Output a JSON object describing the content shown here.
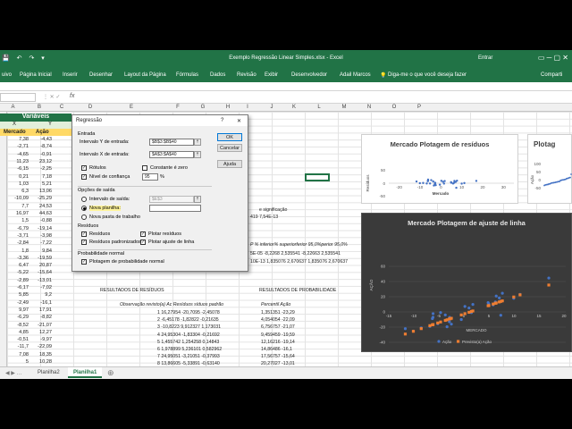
{
  "window": {
    "title": "Exemplo Regressão Linear Simples.xlsx - Excel",
    "sign_in": "Entrar",
    "share": "Comparti"
  },
  "ribbon": {
    "tabs": [
      "uivo",
      "Página Inicial",
      "Inserir",
      "Desenhar",
      "Layout da Página",
      "Fórmulas",
      "Dados",
      "Revisão",
      "Exibir",
      "Desenvolvedor",
      "Adail Marcos"
    ],
    "tell_me": "Diga-me o que você deseja fazer"
  },
  "formula_bar": {
    "fx": "fx"
  },
  "columns": [
    "A",
    "B",
    "C",
    "D",
    "E",
    "F",
    "G",
    "H",
    "I",
    "J",
    "K",
    "L",
    "M",
    "N",
    "O",
    "P"
  ],
  "sheet": {
    "variables_title": "Variáveis",
    "var_x": "X",
    "var_y": "Y",
    "hdr_market": "Mercado",
    "hdr_action": "Ação",
    "rows": [
      [
        "7,38",
        "-4,43"
      ],
      [
        "-2,71",
        "-8,74"
      ],
      [
        "-4,65",
        "-0,91"
      ],
      [
        "11,23",
        "23,12"
      ],
      [
        "-6,15",
        "-2,25"
      ],
      [
        "0,21",
        "7,18"
      ],
      [
        "1,03",
        "5,21"
      ],
      [
        "6,3",
        "13,06"
      ],
      [
        "-10,09",
        "-25,29"
      ],
      [
        "7,7",
        "24,53"
      ],
      [
        "16,97",
        "44,63"
      ],
      [
        "1,5",
        "-0,88"
      ],
      [
        "-6,79",
        "-19,14"
      ],
      [
        "-3,71",
        "-3,98"
      ],
      [
        "-2,84",
        "-7,22"
      ],
      [
        "1,8",
        "9,84"
      ],
      [
        "-3,36",
        "-19,59"
      ],
      [
        "6,47",
        "20,87"
      ],
      [
        "-5,22",
        "-15,64"
      ],
      [
        "-2,89",
        "-13,01"
      ],
      [
        "-6,17",
        "-7,02"
      ],
      [
        "5,85",
        "9,2"
      ],
      [
        "-2,49",
        "-16,1"
      ],
      [
        "9,97",
        "17,91"
      ],
      [
        "-6,29",
        "-8,82"
      ],
      [
        "-8,52",
        "-21,07"
      ],
      [
        "4,85",
        "12,27"
      ],
      [
        "-0,51",
        "-9,97"
      ],
      [
        "-11,7",
        "-22,09"
      ],
      [
        "7,08",
        "18,35"
      ],
      [
        "5",
        "10,28"
      ]
    ],
    "sig_header": "e significação",
    "sig_vals": "419  7,54E-13",
    "ci_header": "P     % inferior% superiorferior 95,0%perior 95,0%",
    "ci_row1": "",
    "ci_row2": "5E-05    -8,2268  2,535541  -8,22663  2,535541",
    "ci_row3": "10E-13  1,835076  2,670637  1,835076  2,670637",
    "residual_title": "RESULTADOS DE RESÍDUOS",
    "residual_cols": "Observação      revisto(a) Ac  Resíduos  síduos padrão",
    "residual_rows": [
      "1  16,27954   -20,7095  -2,45078",
      "2  -6,45178   -1,82822  -0,21635",
      "3  -10,8223  9,912327  1,173031",
      "4  24,95304   -1,83304  -0,21692",
      "5  1,455742  1,254258   0,14843",
      "6  1,978899  5,236101  0,582962",
      "7  24,95051  -3,21051  -0,37993",
      "8  13,86605  -5,33891  -0,63140"
    ],
    "prob_title": "RESULTADOS DE PROBABILIDADE",
    "prob_cols": "Percentil     Ação",
    "prob_rows": [
      "1,351351   -23,29",
      "4,054054   -22,09",
      "6,756757   -21,07",
      "9,459459   -19,59",
      "12,16216   -19,14",
      "14,86486   -16,1",
      "17,56757   -15,64",
      "20,27027   -13,01"
    ]
  },
  "charts": {
    "residuals": {
      "title": "Mercado Plotagem de resíduos",
      "ylabel": "Resíduos",
      "xlabel": "Mercado",
      "yticks": [
        "50",
        "0",
        "-50"
      ],
      "xticks": [
        "-20",
        "-10",
        "0",
        "10",
        "20",
        "30"
      ]
    },
    "probability": {
      "title": "Plotag",
      "ylabel": "Ação",
      "yticks": [
        "100",
        "50",
        "0",
        "-50"
      ]
    },
    "fit": {
      "title": "Mercado Plotagem de ajuste de linha",
      "ylabel": "AÇÃO",
      "xlabel": "MERCADO",
      "yticks": [
        "60",
        "40",
        "20",
        "0",
        "-20",
        "-40"
      ],
      "xticks": [
        "-15",
        "-10",
        "-5",
        "0",
        "5",
        "10",
        "15",
        "20"
      ],
      "legend": [
        "Ação",
        "Previsto(a) Ação"
      ],
      "color_actual": "#4472c4",
      "color_pred": "#ed7d31"
    }
  },
  "dialog": {
    "title": "Regressão",
    "help": "?",
    "close": "✕",
    "ok": "OK",
    "cancel": "Cancelar",
    "help_btn": "Ajuda",
    "input_group": "Entrada",
    "y_label": "Intervalo Y de entrada:",
    "y_value": "$B$3:$B$40",
    "x_label": "Intervalo X de entrada:",
    "x_value": "$A$3:$A$40",
    "labels": "Rótulos",
    "const_zero": "Constante é zero",
    "conf_label": "Nível de confiança",
    "conf_value": "95",
    "conf_pct": "%",
    "output_group": "Opções de saída",
    "out_range": "Intervalo de saída:",
    "out_range_value": "$E$3",
    "new_sheet": "Nova planilha:",
    "new_book": "Nova pasta de trabalho",
    "resid_group": "Resíduos",
    "resid": "Resíduos",
    "plot_resid": "Plotar resíduos",
    "std_resid": "Resíduos padronizados",
    "plot_fit": "Plotar ajuste de linha",
    "norm_group": "Probabilidade normal",
    "norm_plot": "Plotagem de probabilidade normal"
  },
  "tabs": [
    "Planilha2",
    "Planilha1"
  ]
}
